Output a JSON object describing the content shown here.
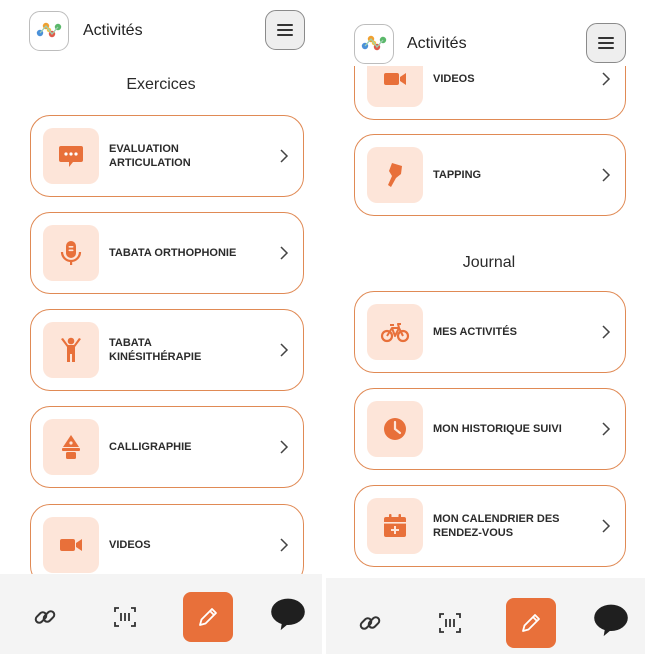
{
  "app_title": "Activités",
  "sections": {
    "exercices": "Exercices",
    "journal": "Journal"
  },
  "exercices": [
    {
      "line1": "EVALUATION",
      "line2": "ARTICULATION",
      "icon": "chat-bubble-icon"
    },
    {
      "line1": "TABATA ORTHOPHONIE",
      "line2": "",
      "icon": "microphone-icon"
    },
    {
      "line1": "TABATA",
      "line2": "KINÉSITHÉRAPIE",
      "icon": "person-arms-up-icon"
    },
    {
      "line1": "CALLIGRAPHIE",
      "line2": "",
      "icon": "pen-nib-icon"
    },
    {
      "line1": "VIDEOS",
      "line2": "",
      "icon": "video-camera-icon"
    },
    {
      "line1": "TAPPING",
      "line2": "",
      "icon": "finger-tap-icon"
    }
  ],
  "journal": [
    {
      "line1": "MES ACTIVITÉS",
      "line2": "",
      "icon": "bicycle-icon"
    },
    {
      "line1": "MON HISTORIQUE SUIVI",
      "line2": "",
      "icon": "clock-icon"
    },
    {
      "line1": "MON CALENDRIER DES",
      "line2": "RENDEZ-VOUS",
      "icon": "calendar-plus-icon"
    }
  ],
  "tabbar": [
    "link-icon",
    "scan-icon",
    "pencil-icon",
    "chat-icon"
  ],
  "colors": {
    "accent": "#e8703a",
    "card_border": "#e08a55",
    "icon_bg": "#fde5d9"
  }
}
